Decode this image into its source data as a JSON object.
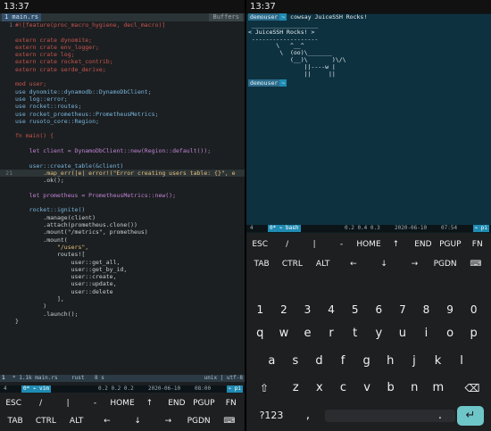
{
  "left": {
    "status_time": "13:37",
    "tab_label": "1  main.rs",
    "buffers_label": "Buffers",
    "code_lines": [
      {
        "n": "1",
        "t": "#![feature(proc_macro_hygiene, decl_macro)]",
        "c": "kw"
      },
      {
        "n": "",
        "t": ""
      },
      {
        "n": "",
        "t": "extern crate dynomite;",
        "c": "kw"
      },
      {
        "n": "",
        "t": "extern crate env_logger;",
        "c": "kw"
      },
      {
        "n": "",
        "t": "extern crate log;",
        "c": "kw"
      },
      {
        "n": "",
        "t": "extern crate rocket_contrib;",
        "c": "kw"
      },
      {
        "n": "",
        "t": "extern crate serde_derive;",
        "c": "kw"
      },
      {
        "n": "",
        "t": ""
      },
      {
        "n": "",
        "t": "mod user;",
        "c": "kw"
      },
      {
        "n": "",
        "t": "use dynomite::dynamodb::DynamoDbClient;",
        "c": "ty"
      },
      {
        "n": "",
        "t": "use log::error;",
        "c": "ty"
      },
      {
        "n": "",
        "t": "use rocket::routes;",
        "c": "ty"
      },
      {
        "n": "",
        "t": "use rocket_prometheus::PrometheusMetrics;",
        "c": "ty"
      },
      {
        "n": "",
        "t": "use rusoto_core::Region;",
        "c": "ty"
      },
      {
        "n": "",
        "t": ""
      },
      {
        "n": "",
        "t": "fn main() {",
        "c": "kw"
      },
      {
        "n": "",
        "t": ""
      },
      {
        "n": "",
        "t": "    let client = DynamoDbClient::new(Region::default());",
        "c": "fn"
      },
      {
        "n": "",
        "t": ""
      },
      {
        "n": "",
        "t": "    user::create_table(&client)",
        "c": "ty"
      },
      {
        "n": "21",
        "t": "        .map_err(|e| error!(\"Error creating users table: {}\", e",
        "c": "st",
        "cur": true
      },
      {
        "n": "",
        "t": "        .ok();"
      },
      {
        "n": "",
        "t": ""
      },
      {
        "n": "",
        "t": "    let prometheus = PrometheusMetrics::new();",
        "c": "fn"
      },
      {
        "n": "",
        "t": ""
      },
      {
        "n": "",
        "t": "    rocket::ignite()",
        "c": "ty"
      },
      {
        "n": "",
        "t": "        .manage(client)"
      },
      {
        "n": "",
        "t": "        .attach(prometheus.clone())"
      },
      {
        "n": "",
        "t": "        .mount(\"/metrics\", prometheus)"
      },
      {
        "n": "",
        "t": "        .mount("
      },
      {
        "n": "",
        "t": "            \"/users\",",
        "c": "st"
      },
      {
        "n": "",
        "t": "            routes!["
      },
      {
        "n": "",
        "t": "                user::get_all,"
      },
      {
        "n": "",
        "t": "                user::get_by_id,"
      },
      {
        "n": "",
        "t": "                user::create,"
      },
      {
        "n": "",
        "t": "                user::update,"
      },
      {
        "n": "",
        "t": "                user::delete"
      },
      {
        "n": "",
        "t": "            ],"
      },
      {
        "n": "",
        "t": "        )"
      },
      {
        "n": "",
        "t": "        .launch();"
      },
      {
        "n": "",
        "t": "}"
      }
    ],
    "vim_status": {
      "mode": "1",
      "file": "* 1.1k main.rs",
      "lang": "rust",
      "pos": "8 s",
      "enc": "unix | utf-8"
    },
    "tmux": {
      "win": "4",
      "name": "0* ⌁ vim",
      "load": "0.2 0.2 0.2",
      "date": "2020-06-10",
      "time": "08:00",
      "host": "⌁ pi"
    },
    "extra_keys_row1": [
      "ESC",
      "/",
      "|",
      "-",
      "HOME",
      "↑",
      "END",
      "PGUP",
      "FN"
    ],
    "extra_keys_row2": [
      "TAB",
      "CTRL",
      "ALT",
      "←",
      "↓",
      "→",
      "PGDN",
      "⌨"
    ]
  },
  "right": {
    "status_time": "13:37",
    "prompt_user": "demouser",
    "prompt_sep": "~",
    "command": "cowsay JuiceSSH Rocks!",
    "cow_lines": [
      " ___________________",
      "< JuiceSSH Rocks! >",
      " -------------------",
      "        \\   ^__^",
      "         \\  (oo)\\_______",
      "            (__)\\       )\\/\\",
      "                ||----w |",
      "                ||     ||"
    ],
    "prompt2_user": "demouser",
    "prompt2_sep": "~",
    "tmux": {
      "win": "4",
      "name": "0* ⌁ bash",
      "load": "0.2 0.4 0.3",
      "date": "2020-06-10",
      "time": "07:54",
      "host": "⌁ pi"
    },
    "extra_keys_row1": [
      "ESC",
      "/",
      "|",
      "-",
      "HOME",
      "↑",
      "END",
      "PGUP",
      "FN"
    ],
    "extra_keys_row2": [
      "TAB",
      "CTRL",
      "ALT",
      "←",
      "↓",
      "→",
      "PGDN",
      "⌨"
    ],
    "number_row": [
      "1",
      "2",
      "3",
      "4",
      "5",
      "6",
      "7",
      "8",
      "9",
      "0"
    ],
    "row_q": [
      "q",
      "w",
      "e",
      "r",
      "t",
      "y",
      "u",
      "i",
      "o",
      "p"
    ],
    "row_a": [
      "a",
      "s",
      "d",
      "f",
      "g",
      "h",
      "j",
      "k",
      "l"
    ],
    "row_z": [
      "z",
      "x",
      "c",
      "v",
      "b",
      "n",
      "m"
    ],
    "bottom": {
      "sym": "?123",
      "comma": ",",
      "period": "."
    },
    "accent": "#6fc6c8"
  }
}
